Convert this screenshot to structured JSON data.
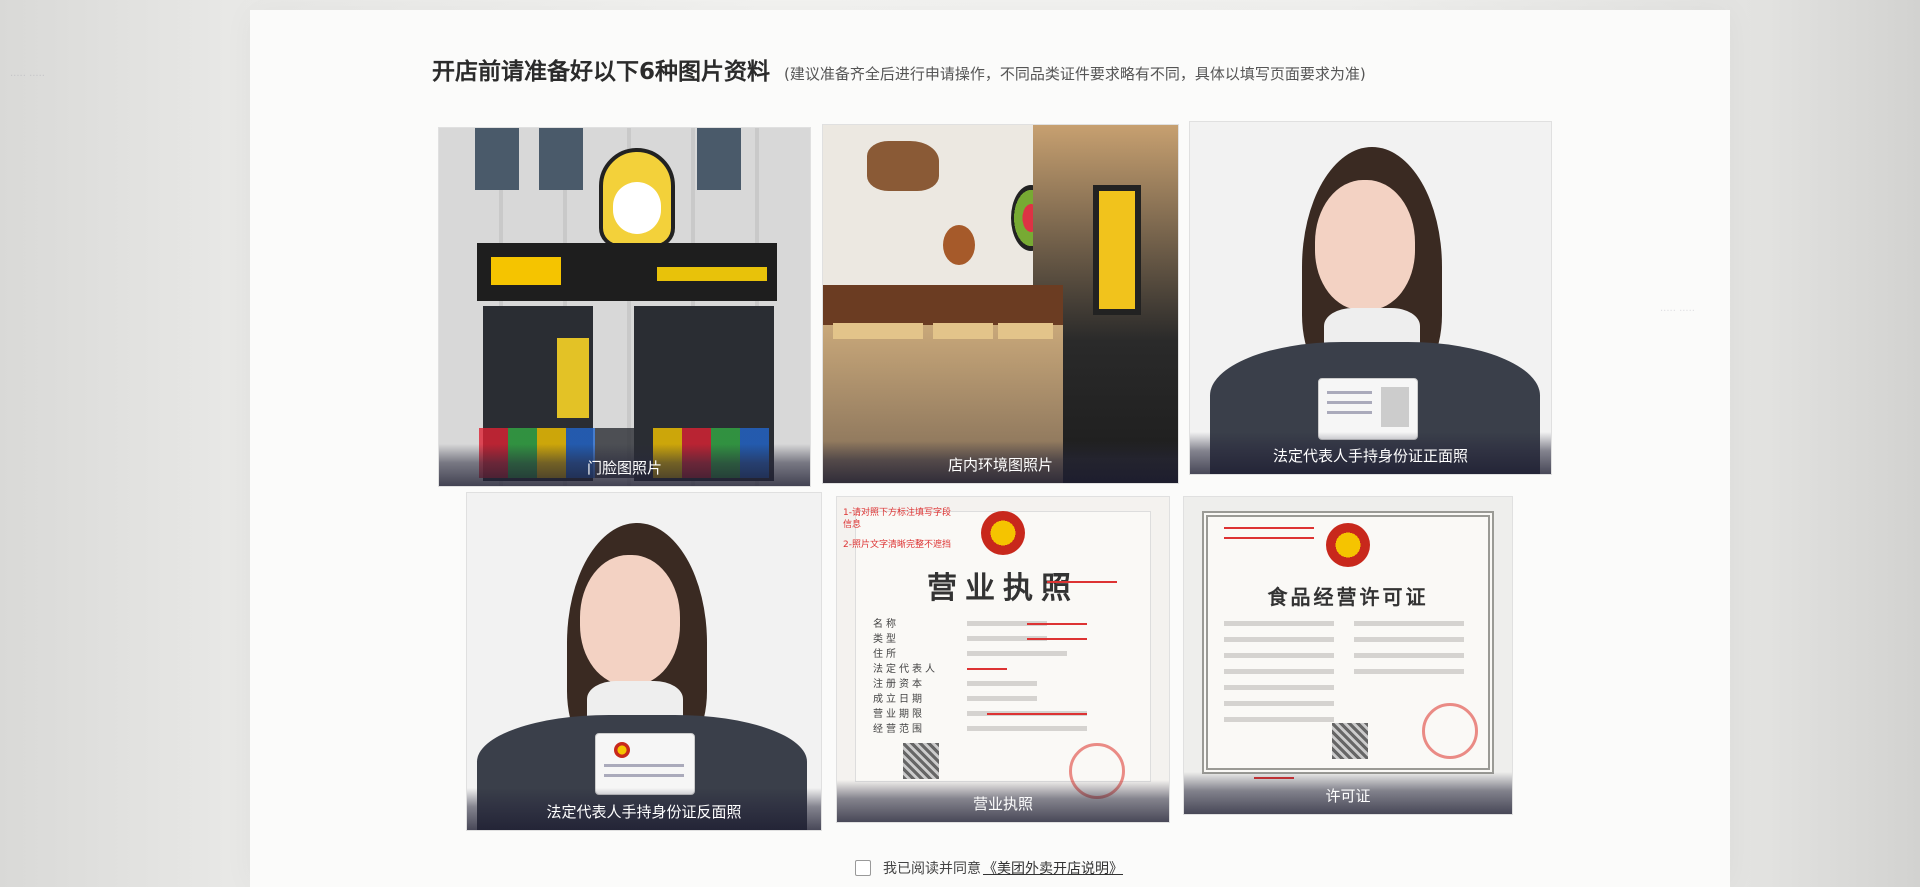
{
  "heading": {
    "title": "开店前请准备好以下6种图片资料",
    "note": "(建议准备齐全后进行申请操作，不同品类证件要求略有不同，具体以填写页面要求为准)"
  },
  "cards": [
    {
      "caption": "门脸图照片"
    },
    {
      "caption": "店内环境图照片"
    },
    {
      "caption": "法定代表人手持身份证正面照"
    },
    {
      "caption": "法定代表人手持身份证反面照"
    },
    {
      "caption": "营业执照",
      "doc_title": "营业执照",
      "notes": [
        "1-请对照下方标注填写字段信息",
        "2-照片文字清晰完整不遮挡"
      ],
      "fields": [
        "名称",
        "类型",
        "住所",
        "法定代表人",
        "注册资本",
        "成立日期",
        "营业期限",
        "经营范围"
      ]
    },
    {
      "caption": "许可证",
      "doc_title": "食品经营许可证"
    }
  ],
  "agreement": {
    "prefix": "我已阅读并同意",
    "link": "《美团外卖开店说明》"
  },
  "colors": {
    "heading": "#2b2b2b",
    "caption_text": "#ffffff",
    "note_red": "#dd3333",
    "emblem_red": "#c8281c",
    "emblem_gold": "#f5c400"
  },
  "icons": [
    "checkbox-icon",
    "national-emblem-icon",
    "qr-code-icon",
    "official-seal-icon"
  ]
}
